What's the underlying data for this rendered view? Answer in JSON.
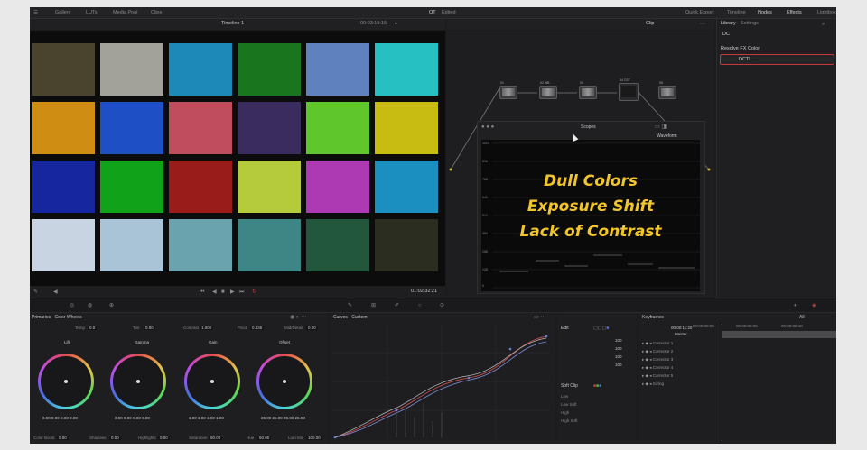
{
  "topbar": {
    "items": [
      "Gallery",
      "LUTs",
      "Media Pool",
      "Clips"
    ],
    "project_title": "QT",
    "project_status": "Edited",
    "right_items": [
      "Quick Export",
      "Timeline",
      "Nodes",
      "Effects",
      "Lightbox"
    ]
  },
  "viewer": {
    "timeline_name": "Timeline 1",
    "zoom": "00:03:19:15",
    "timecode": "01:02:32:21",
    "patches": [
      "#4a442e",
      "#a3a29a",
      "#1c89b8",
      "#19761f",
      "#5f82bf",
      "#27c0c2",
      "#d08d14",
      "#1f4fc4",
      "#c04d5e",
      "#3a2c5e",
      "#5fc72c",
      "#c8bb12",
      "#15269f",
      "#10a218",
      "#9a1c1a",
      "#b5cb3c",
      "#ad3ab3",
      "#1a8fc0",
      "#c8d4e2",
      "#a9c4d6",
      "#6aa3ae",
      "#3e8686",
      "#23573d",
      "#2b2d20"
    ]
  },
  "nodes": {
    "clip_label": "Clip",
    "node_labels": [
      "01",
      "02 WB",
      "03",
      "04 CST",
      "05"
    ]
  },
  "library": {
    "tabs": [
      "Library",
      "Settings"
    ],
    "search_value": "DC",
    "section_title": "Resolve FX Color",
    "item_label": "DCTL"
  },
  "scopes": {
    "title": "Scopes",
    "mode": "Waveform",
    "y_ticks": [
      "1023",
      "896",
      "768",
      "640",
      "512",
      "384",
      "256",
      "128",
      "0"
    ],
    "overlay_lines": [
      "Dull Colors",
      "Exposure Shift",
      "Lack of Contrast"
    ]
  },
  "wheels": {
    "title": "Primaries - Color Wheels",
    "params": [
      {
        "label": "Temp",
        "value": "0.0"
      },
      {
        "label": "Tint",
        "value": "0.00"
      },
      {
        "label": "Contrast",
        "value": "1.000"
      },
      {
        "label": "Pivot",
        "value": "0.435"
      },
      {
        "label": "Mid/Detail",
        "value": "0.00"
      }
    ],
    "wheel_names": [
      "Lift",
      "Gamma",
      "Gain",
      "Offset"
    ],
    "wheel_values": [
      [
        "0.00",
        "0.00",
        "0.00",
        "0.00"
      ],
      [
        "0.00",
        "0.00",
        "0.00",
        "0.00"
      ],
      [
        "1.00",
        "1.00",
        "1.00",
        "1.00"
      ],
      [
        "25.00",
        "25.00",
        "25.00",
        "25.00"
      ]
    ],
    "bottom_params": [
      {
        "label": "Color Boost",
        "value": "0.00"
      },
      {
        "label": "Shadows",
        "value": "0.00"
      },
      {
        "label": "Highlights",
        "value": "0.00"
      },
      {
        "label": "Saturation",
        "value": "50.00"
      },
      {
        "label": "Hue",
        "value": "50.00"
      },
      {
        "label": "Lum Mix",
        "value": "100.00"
      }
    ]
  },
  "curves": {
    "title": "Curves - Custom"
  },
  "softclip": {
    "edit_label": "Edit",
    "channel_values": [
      "100",
      "100",
      "100",
      "100"
    ],
    "soft_clip_label": "Soft Clip",
    "rows": [
      "Low",
      "Low Soft",
      "High",
      "High Soft"
    ]
  },
  "keyframes": {
    "title": "Keyframes",
    "filter": "All",
    "time_start": "00:00:00:00",
    "time_mid": "00:00:00:05",
    "time_end": "00:00:00:10",
    "track_master": "Master",
    "master_time": "00:00:11:20",
    "tracks": [
      "Corrector 1",
      "Corrector 2",
      "Corrector 3",
      "Corrector 4",
      "Corrector 5",
      "Sizing"
    ]
  }
}
